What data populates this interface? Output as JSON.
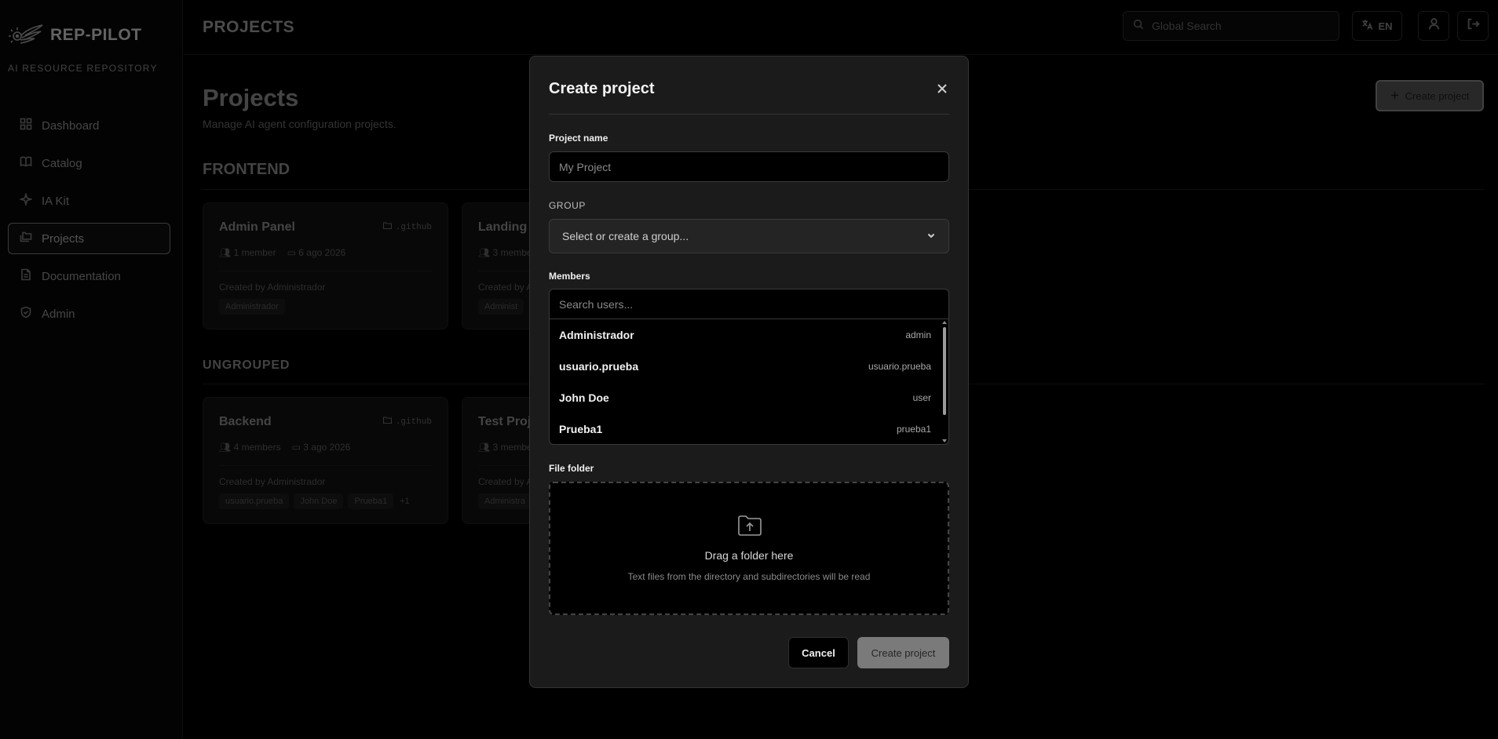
{
  "sidebar": {
    "brand": "REP-PILOT",
    "tagline": "AI RESOURCE REPOSITORY",
    "items": [
      {
        "label": "Dashboard",
        "icon": "dashboard-icon"
      },
      {
        "label": "Catalog",
        "icon": "book-icon"
      },
      {
        "label": "IA Kit",
        "icon": "sparkle-icon"
      },
      {
        "label": "Projects",
        "icon": "folders-icon",
        "active": true
      },
      {
        "label": "Documentation",
        "icon": "document-icon"
      },
      {
        "label": "Admin",
        "icon": "shield-icon"
      }
    ]
  },
  "header": {
    "title": "PROJECTS",
    "search_placeholder": "Global Search",
    "language": "EN"
  },
  "main": {
    "title": "Projects",
    "subtitle": "Manage AI agent configuration projects.",
    "create_button": "Create project",
    "groups": [
      {
        "name": "FRONTEND",
        "cards": [
          {
            "title": "Admin Panel",
            "folder": ".github",
            "members": "1 member",
            "date": "6 ago 2026",
            "created_by": "Created by Administrador",
            "chips": [
              "Administrador"
            ]
          },
          {
            "title": "Landing P",
            "folder": "",
            "members": "3 members",
            "date": "",
            "created_by": "Created by A",
            "chips": [
              "Administ"
            ]
          }
        ]
      },
      {
        "name": "UNGROUPED",
        "cards": [
          {
            "title": "Backend",
            "folder": ".github",
            "members": "4 members",
            "date": "3 ago 2026",
            "created_by": "Created by Administrador",
            "chips": [
              "usuario.prueba",
              "John Doe",
              "Prueba1"
            ],
            "more": "+1"
          },
          {
            "title": "Test Proje",
            "folder": "",
            "members": "3 members",
            "date": "",
            "created_by": "Created by A",
            "chips": [
              "Administra"
            ]
          }
        ]
      }
    ]
  },
  "modal": {
    "title": "Create project",
    "project_name_label": "Project name",
    "project_name_placeholder": "My Project",
    "project_name_value": "",
    "group_label": "GROUP",
    "group_placeholder": "Select or create a group...",
    "members_label": "Members",
    "members_search_placeholder": "Search users...",
    "users": [
      {
        "name": "Administrador",
        "username": "admin"
      },
      {
        "name": "usuario.prueba",
        "username": "usuario.prueba"
      },
      {
        "name": "John Doe",
        "username": "user"
      },
      {
        "name": "Prueba1",
        "username": "prueba1"
      }
    ],
    "folder_label": "File folder",
    "dropzone_title": "Drag a folder here",
    "dropzone_sub": "Text files from the directory and subdirectories will be read",
    "cancel": "Cancel",
    "submit": "Create project"
  }
}
